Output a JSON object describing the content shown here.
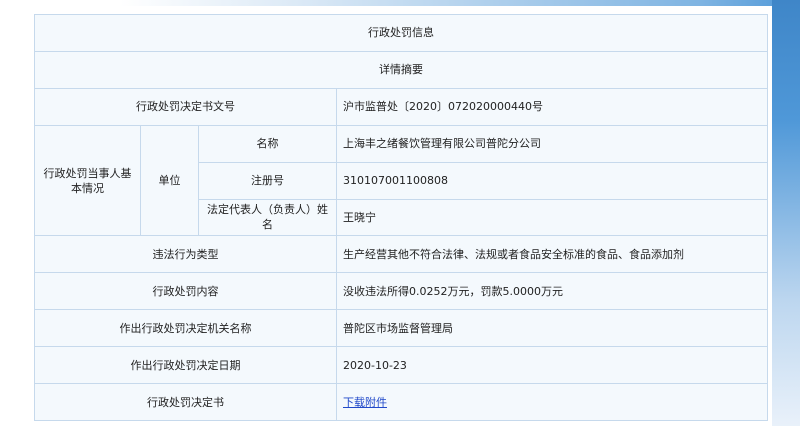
{
  "table": {
    "title": "行政处罚信息",
    "subtitle": "详情摘要",
    "rows": {
      "decision_no": {
        "label": "行政处罚决定书文号",
        "value": "沪市监普处〔2020〕072020000440号"
      },
      "party": {
        "label": "行政处罚当事人基本情况",
        "unit_label": "单位",
        "name": {
          "label": "名称",
          "value": "上海丰之绪餐饮管理有限公司普陀分公司"
        },
        "reg_no": {
          "label": "注册号",
          "value": "310107001100808"
        },
        "legal_rep": {
          "label": "法定代表人（负责人）姓名",
          "value": "王晓宁"
        }
      },
      "violation_type": {
        "label": "违法行为类型",
        "value": "生产经营其他不符合法律、法规或者食品安全标准的食品、食品添加剂"
      },
      "penalty_content": {
        "label": "行政处罚内容",
        "value": "没收违法所得0.0252万元，罚款5.0000万元"
      },
      "authority": {
        "label": "作出行政处罚决定机关名称",
        "value": "普陀区市场监督管理局"
      },
      "decision_date": {
        "label": "作出行政处罚决定日期",
        "value": "2020-10-23"
      },
      "decision_doc": {
        "label": "行政处罚决定书",
        "link_text": "下载附件"
      }
    }
  },
  "colors": {
    "border": "#c6d9ec",
    "cell_bg": "#f4f9fd",
    "link": "#2149c9",
    "accent": "#4f98d8"
  }
}
